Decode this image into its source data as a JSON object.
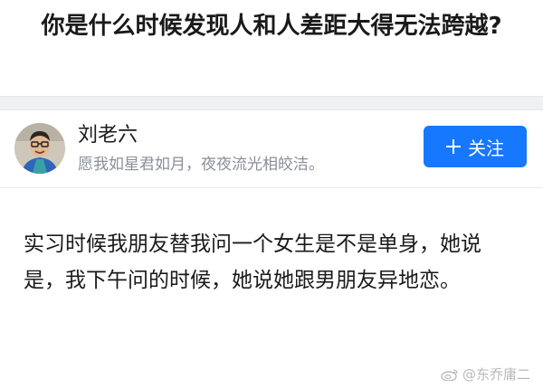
{
  "question": {
    "title": "你是什么时候发现人和人差距大得无法跨越?"
  },
  "author": {
    "name": "刘老六",
    "bio": "愿我如星君如月，夜夜流光相皎洁。"
  },
  "follow_button": {
    "label": "关注",
    "icon": "plus-icon",
    "color": "#1677ff"
  },
  "answer": {
    "text": "实习时候我朋友替我问一个女生是不是单身，她说是，我下午问的时候，她说她跟男朋友异地恋。"
  },
  "watermark": {
    "text": "@东乔庸二",
    "icon": "weibo-icon"
  }
}
